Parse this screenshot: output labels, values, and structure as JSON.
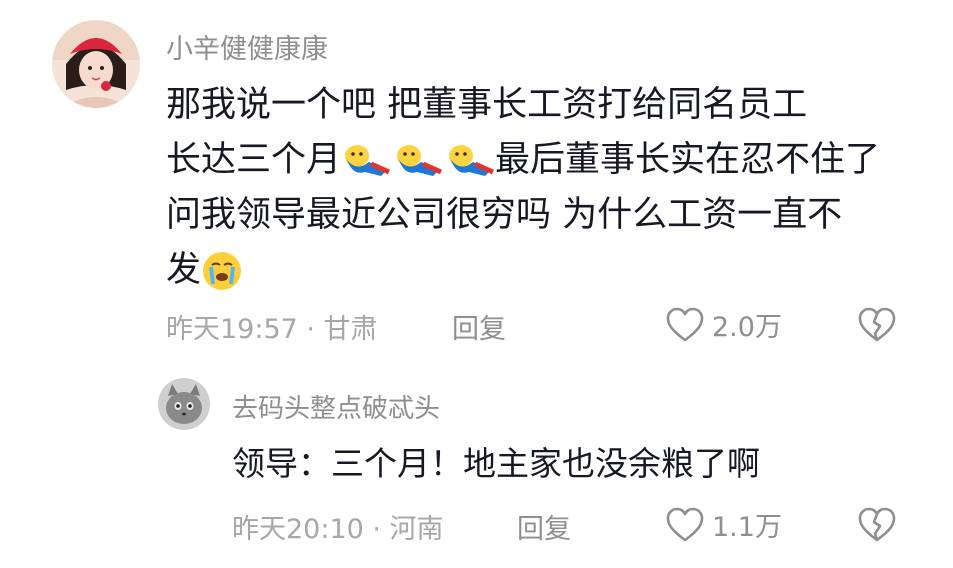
{
  "comments": [
    {
      "username": "小辛健健康康",
      "text_line1": "那我说一个吧  把董事长工资打给同名员工",
      "text_line2_prefix": "长达三个月",
      "text_line2_suffix": "最后董事长实在忍不住了",
      "text_line3": "问我领导最近公司很穷吗 为什么工资一直不",
      "text_line4": "发",
      "time": "昨天19:57 · 甘肃",
      "reply_label": "回复",
      "likes": "2.0万",
      "avatar_colors": {
        "hat": "#d8263a",
        "bg": "#f6e3d8",
        "hair": "#2a1d1a"
      }
    },
    {
      "username": "去码头整点破忒头",
      "text": "领导：三个月！地主家也没余粮了啊",
      "time": "昨天20:10 · 河南",
      "reply_label": "回复",
      "likes": "1.1万"
    }
  ],
  "colors": {
    "username": "#8e8e93",
    "text": "#161823",
    "meta": "#a6a6ab"
  }
}
